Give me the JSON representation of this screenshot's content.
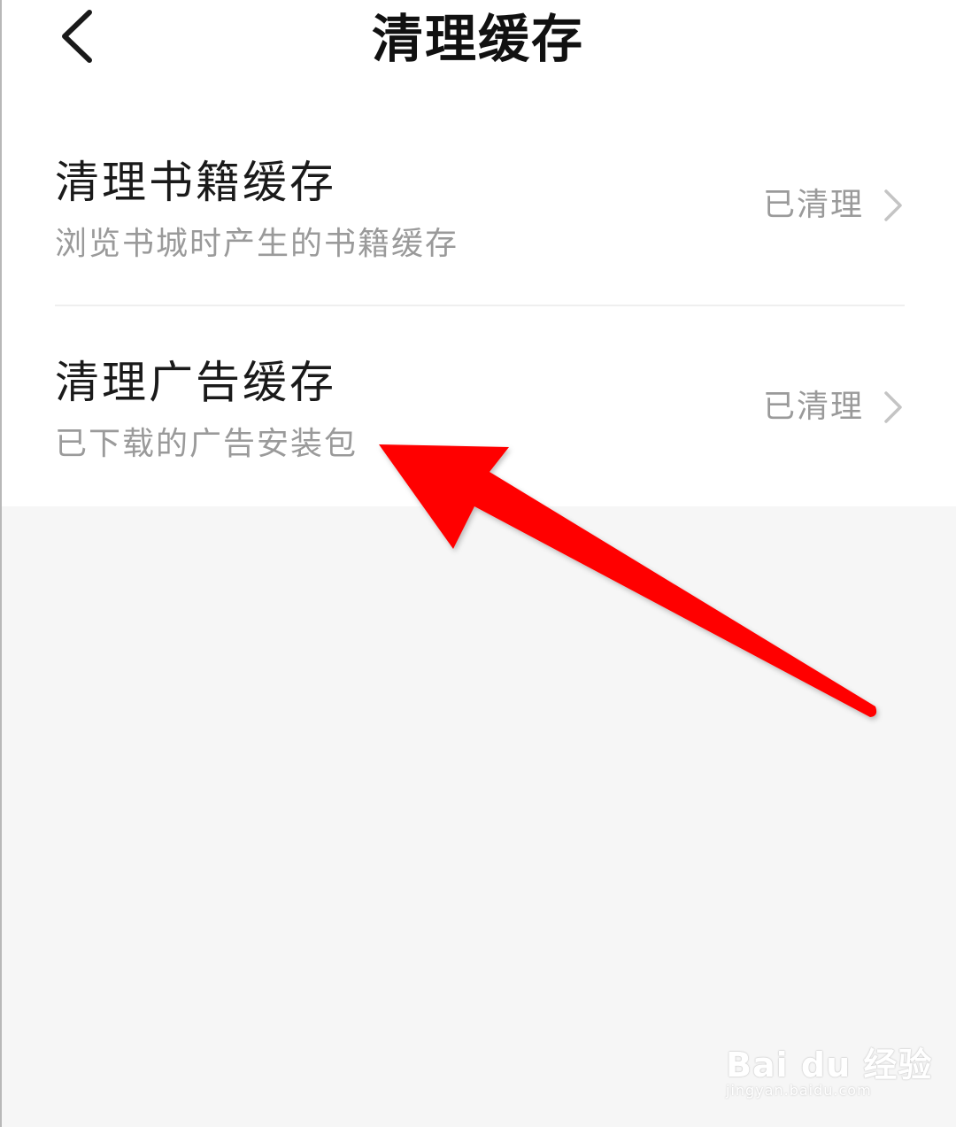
{
  "header": {
    "title": "清理缓存",
    "back_icon": "chevron-left-icon"
  },
  "items": [
    {
      "title": "清理书籍缓存",
      "subtitle": "浏览书城时产生的书籍缓存",
      "status": "已清理"
    },
    {
      "title": "清理广告缓存",
      "subtitle": "已下载的广告安装包",
      "status": "已清理"
    }
  ],
  "annotation": {
    "arrow_color": "#ff0000"
  },
  "watermark": {
    "brand": "Bai du 经验",
    "url": "jingyan.baidu.com"
  }
}
